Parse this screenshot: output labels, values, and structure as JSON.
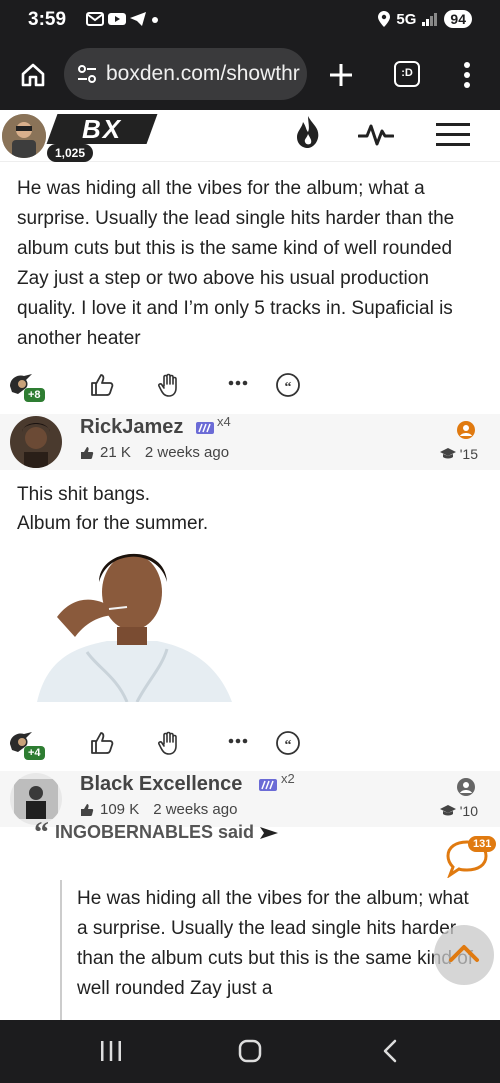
{
  "status_bar": {
    "time": "3:59",
    "network": "5G",
    "battery": "94",
    "icons": [
      "gmail-icon",
      "youtube-icon",
      "telegram-icon",
      "dot-icon",
      "location-icon",
      "signal-icon"
    ]
  },
  "browser": {
    "url": "boxden.com/showthr",
    "tab_switcher_label": ":D"
  },
  "site_header": {
    "logo_text": "BX",
    "user_count": "1,025",
    "icons": [
      "fire-icon",
      "activity-icon",
      "menu-icon"
    ]
  },
  "post1": {
    "text": "He was hiding all the vibes for the album; what a surprise. Usually the lead single hits harder than the album cuts but this is the same kind of well rounded Zay just a step or two above his usual production quality. I love it and I’m only 5 tracks in. Supaficial is another heater",
    "reactions": {
      "plus": "+8"
    }
  },
  "user1": {
    "name": "RickJamez",
    "multiplier": "x4",
    "likes": "21 K",
    "time": "2 weeks ago",
    "year": "'15"
  },
  "post2": {
    "line1": "This shit bangs.",
    "line2": "Album for the summer.",
    "reactions": {
      "plus": "+4"
    }
  },
  "user2": {
    "name": "Black Excellence",
    "multiplier": "x2",
    "likes": "109 K",
    "time": "2 weeks ago",
    "year": "'10"
  },
  "quote": {
    "author_line": "INGOBERNABLES said",
    "text": "He was hiding all the vibes for the album; what a surprise. Usually the lead single hits harder than the album cuts but this is the same kind of well rounded Zay just a"
  },
  "chat": {
    "badge": "131"
  },
  "colors": {
    "accent": "#e07a10",
    "dark": "#1c1c1e",
    "green": "#2e7d32"
  }
}
